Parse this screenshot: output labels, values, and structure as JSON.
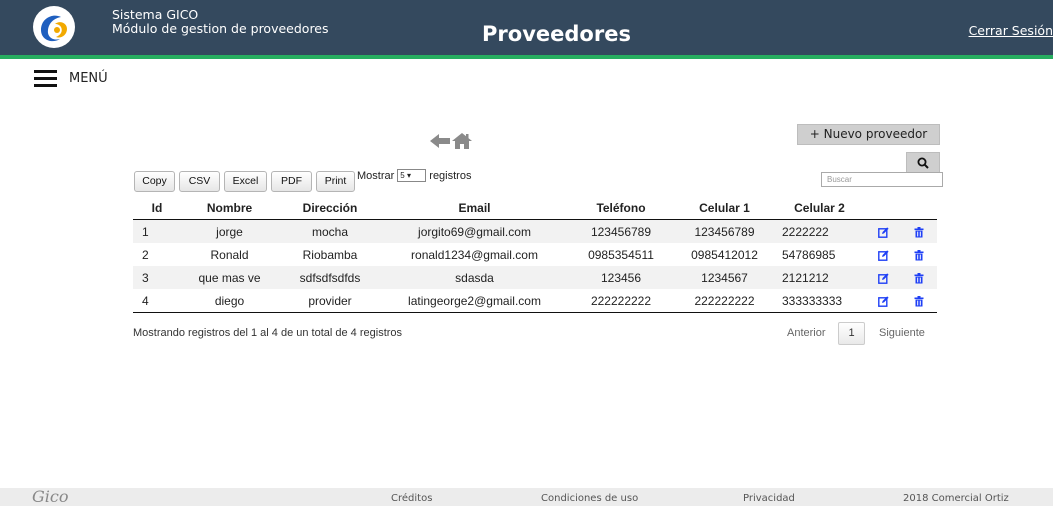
{
  "header": {
    "system_name": "Sistema GICO",
    "module_name": "Módulo de gestion de proveedores",
    "title": "Proveedores",
    "logout_label": "Cerrar Sesión"
  },
  "menu": {
    "label": "MENÚ"
  },
  "toolbar": {
    "new_provider_label": "+ Nuevo proveedor",
    "search_placeholder": "Buscar",
    "export_buttons": [
      "Copy",
      "CSV",
      "Excel",
      "PDF",
      "Print"
    ],
    "show_prefix": "Mostrar",
    "show_value": "5",
    "show_suffix": "registros"
  },
  "table": {
    "columns": [
      "Id",
      "Nombre",
      "Dirección",
      "Email",
      "Teléfono",
      "Celular 1",
      "Celular 2"
    ],
    "rows": [
      [
        "1",
        "jorge",
        "mocha",
        "jorgito69@gmail.com",
        "123456789",
        "123456789",
        "2222222"
      ],
      [
        "2",
        "Ronald",
        "Riobamba",
        "ronald1234@gmail.com",
        "0985354511",
        "0985412012",
        "54786985"
      ],
      [
        "3",
        "que mas ve",
        "sdfsdfsdfds",
        "sdasda",
        "123456",
        "1234567",
        "2121212"
      ],
      [
        "4",
        "diego",
        "provider",
        "latingeorge2@gmail.com",
        "222222222",
        "222222222",
        "333333333"
      ]
    ]
  },
  "pagination": {
    "info": "Mostrando registros del 1 al 4 de un total de 4 registros",
    "previous": "Anterior",
    "current_page": "1",
    "next": "Siguiente"
  },
  "footer": {
    "logo_text": "Gico",
    "credits": "Créditos",
    "terms": "Condiciones de uso",
    "privacy": "Privacidad",
    "copyright": "2018 Comercial Ortiz"
  },
  "colors": {
    "header_bg": "#34495e",
    "header_accent": "#27ae60",
    "action_icon": "#1e3ff5"
  },
  "icons": [
    "hamburger-menu-icon",
    "back-arrow-icon",
    "home-icon",
    "search-icon",
    "edit-icon",
    "trash-icon"
  ]
}
